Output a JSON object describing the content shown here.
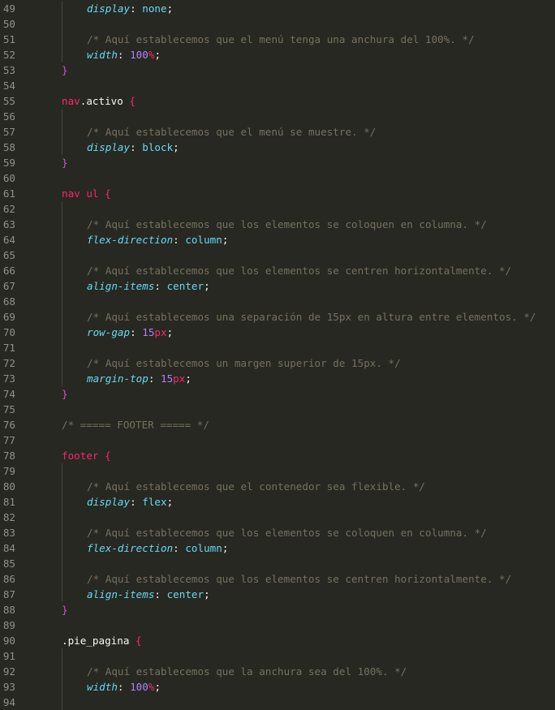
{
  "lines": [
    {
      "n": "49",
      "tokens": [
        {
          "t": "display",
          "c": "prop"
        },
        {
          "t": ": ",
          "c": "punct"
        },
        {
          "t": "none",
          "c": "val"
        },
        {
          "t": ";",
          "c": "punct"
        }
      ],
      "indent": 2
    },
    {
      "n": "50",
      "tokens": [],
      "indent": 2
    },
    {
      "n": "51",
      "tokens": [
        {
          "t": "/* Aquí establecemos que el menú tenga una anchura del 100%. */",
          "c": "comment"
        }
      ],
      "indent": 2
    },
    {
      "n": "52",
      "tokens": [
        {
          "t": "width",
          "c": "prop"
        },
        {
          "t": ": ",
          "c": "punct"
        },
        {
          "t": "100",
          "c": "num"
        },
        {
          "t": "%",
          "c": "unit"
        },
        {
          "t": ";",
          "c": "punct"
        }
      ],
      "indent": 2
    },
    {
      "n": "53",
      "tokens": [
        {
          "t": "}",
          "c": "brace-close"
        }
      ],
      "indent": 1
    },
    {
      "n": "54",
      "tokens": [],
      "indent": 1
    },
    {
      "n": "55",
      "tokens": [
        {
          "t": "nav",
          "c": "sel"
        },
        {
          "t": ".activo ",
          "c": "plain"
        },
        {
          "t": "{",
          "c": "brace"
        }
      ],
      "indent": 1
    },
    {
      "n": "56",
      "tokens": [],
      "indent": 2
    },
    {
      "n": "57",
      "tokens": [
        {
          "t": "/* Aquí establecemos que el menú se muestre. */",
          "c": "comment"
        }
      ],
      "indent": 2
    },
    {
      "n": "58",
      "tokens": [
        {
          "t": "display",
          "c": "prop"
        },
        {
          "t": ": ",
          "c": "punct"
        },
        {
          "t": "block",
          "c": "val"
        },
        {
          "t": ";",
          "c": "punct"
        }
      ],
      "indent": 2
    },
    {
      "n": "59",
      "tokens": [
        {
          "t": "}",
          "c": "brace-close"
        }
      ],
      "indent": 1
    },
    {
      "n": "60",
      "tokens": [],
      "indent": 1
    },
    {
      "n": "61",
      "tokens": [
        {
          "t": "nav ul ",
          "c": "sel"
        },
        {
          "t": "{",
          "c": "brace"
        }
      ],
      "indent": 1
    },
    {
      "n": "62",
      "tokens": [],
      "indent": 2
    },
    {
      "n": "63",
      "tokens": [
        {
          "t": "/* Aquí establecemos que los elementos se coloquen en columna. */",
          "c": "comment"
        }
      ],
      "indent": 2
    },
    {
      "n": "64",
      "tokens": [
        {
          "t": "flex-direction",
          "c": "prop"
        },
        {
          "t": ": ",
          "c": "punct"
        },
        {
          "t": "column",
          "c": "val"
        },
        {
          "t": ";",
          "c": "punct"
        }
      ],
      "indent": 2
    },
    {
      "n": "65",
      "tokens": [],
      "indent": 2
    },
    {
      "n": "66",
      "tokens": [
        {
          "t": "/* Aquí establecemos que los elementos se centren horizontalmente. */",
          "c": "comment"
        }
      ],
      "indent": 2
    },
    {
      "n": "67",
      "tokens": [
        {
          "t": "align-items",
          "c": "prop"
        },
        {
          "t": ": ",
          "c": "punct"
        },
        {
          "t": "center",
          "c": "val"
        },
        {
          "t": ";",
          "c": "punct"
        }
      ],
      "indent": 2
    },
    {
      "n": "68",
      "tokens": [],
      "indent": 2
    },
    {
      "n": "69",
      "tokens": [
        {
          "t": "/* Aquí establecemos una separación de 15px en altura entre elementos. */",
          "c": "comment"
        }
      ],
      "indent": 2
    },
    {
      "n": "70",
      "tokens": [
        {
          "t": "row-gap",
          "c": "prop"
        },
        {
          "t": ": ",
          "c": "punct"
        },
        {
          "t": "15",
          "c": "num"
        },
        {
          "t": "px",
          "c": "unit"
        },
        {
          "t": ";",
          "c": "punct"
        }
      ],
      "indent": 2
    },
    {
      "n": "71",
      "tokens": [],
      "indent": 2
    },
    {
      "n": "72",
      "tokens": [
        {
          "t": "/* Aquí establecemos un margen superior de 15px. */",
          "c": "comment"
        }
      ],
      "indent": 2
    },
    {
      "n": "73",
      "tokens": [
        {
          "t": "margin-top",
          "c": "prop"
        },
        {
          "t": ": ",
          "c": "punct"
        },
        {
          "t": "15",
          "c": "num"
        },
        {
          "t": "px",
          "c": "unit"
        },
        {
          "t": ";",
          "c": "punct"
        }
      ],
      "indent": 2
    },
    {
      "n": "74",
      "tokens": [
        {
          "t": "}",
          "c": "brace-close"
        }
      ],
      "indent": 1
    },
    {
      "n": "75",
      "tokens": [],
      "indent": 1
    },
    {
      "n": "76",
      "tokens": [
        {
          "t": "/* ===== FOOTER ===== */",
          "c": "comment"
        }
      ],
      "indent": 1
    },
    {
      "n": "77",
      "tokens": [],
      "indent": 1
    },
    {
      "n": "78",
      "tokens": [
        {
          "t": "footer ",
          "c": "sel"
        },
        {
          "t": "{",
          "c": "brace"
        }
      ],
      "indent": 1
    },
    {
      "n": "79",
      "tokens": [],
      "indent": 2
    },
    {
      "n": "80",
      "tokens": [
        {
          "t": "/* Aquí establecemos que el contenedor sea flexible. */",
          "c": "comment"
        }
      ],
      "indent": 2
    },
    {
      "n": "81",
      "tokens": [
        {
          "t": "display",
          "c": "prop"
        },
        {
          "t": ": ",
          "c": "punct"
        },
        {
          "t": "flex",
          "c": "val"
        },
        {
          "t": ";",
          "c": "punct"
        }
      ],
      "indent": 2
    },
    {
      "n": "82",
      "tokens": [],
      "indent": 2
    },
    {
      "n": "83",
      "tokens": [
        {
          "t": "/* Aquí establecemos que los elementos se coloquen en columna. */",
          "c": "comment"
        }
      ],
      "indent": 2
    },
    {
      "n": "84",
      "tokens": [
        {
          "t": "flex-direction",
          "c": "prop"
        },
        {
          "t": ": ",
          "c": "punct"
        },
        {
          "t": "column",
          "c": "val"
        },
        {
          "t": ";",
          "c": "punct"
        }
      ],
      "indent": 2
    },
    {
      "n": "85",
      "tokens": [],
      "indent": 2
    },
    {
      "n": "86",
      "tokens": [
        {
          "t": "/* Aquí establecemos que los elementos se centren horizontalmente. */",
          "c": "comment"
        }
      ],
      "indent": 2
    },
    {
      "n": "87",
      "tokens": [
        {
          "t": "align-items",
          "c": "prop"
        },
        {
          "t": ": ",
          "c": "punct"
        },
        {
          "t": "center",
          "c": "val"
        },
        {
          "t": ";",
          "c": "punct"
        }
      ],
      "indent": 2
    },
    {
      "n": "88",
      "tokens": [
        {
          "t": "}",
          "c": "brace-close"
        }
      ],
      "indent": 1
    },
    {
      "n": "89",
      "tokens": [],
      "indent": 1
    },
    {
      "n": "90",
      "tokens": [
        {
          "t": ".pie_pagina ",
          "c": "plain"
        },
        {
          "t": "{",
          "c": "brace"
        }
      ],
      "indent": 1
    },
    {
      "n": "91",
      "tokens": [],
      "indent": 2
    },
    {
      "n": "92",
      "tokens": [
        {
          "t": "/* Aquí establecemos que la anchura sea del 100%. */",
          "c": "comment"
        }
      ],
      "indent": 2
    },
    {
      "n": "93",
      "tokens": [
        {
          "t": "width",
          "c": "prop"
        },
        {
          "t": ": ",
          "c": "punct"
        },
        {
          "t": "100",
          "c": "num"
        },
        {
          "t": "%",
          "c": "unit"
        },
        {
          "t": ";",
          "c": "punct"
        }
      ],
      "indent": 2
    },
    {
      "n": "94",
      "tokens": [],
      "indent": 2
    }
  ],
  "colors": {
    "background": "#272822",
    "line_number": "#90908a",
    "comment": "#75715e",
    "selector": "#f92672",
    "property": "#66d9ef",
    "value": "#66d9ef",
    "number": "#ae81ff",
    "unit": "#f92672",
    "brace_close": "#d351d3",
    "indent_guide": "#464741"
  }
}
